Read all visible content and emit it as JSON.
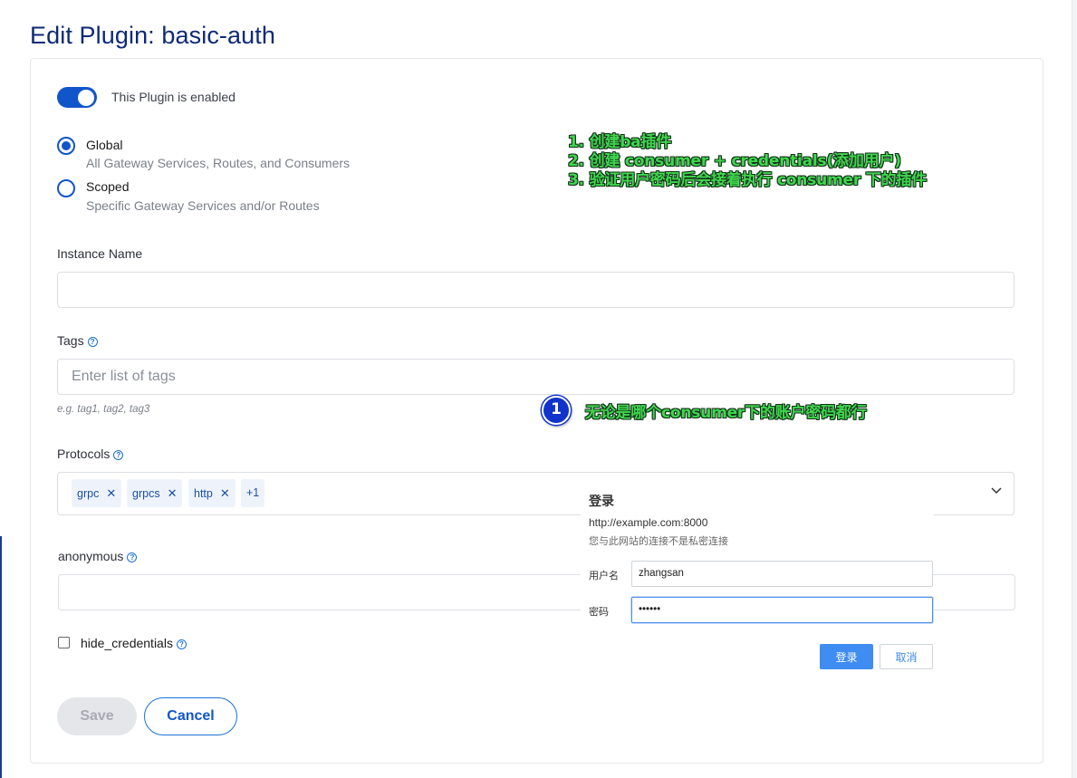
{
  "page": {
    "title": "Edit Plugin: basic-auth"
  },
  "toggle": {
    "label": "This Plugin is enabled",
    "enabled": true
  },
  "scope": {
    "options": [
      {
        "title": "Global",
        "description": "All Gateway Services, Routes, and Consumers",
        "selected": true
      },
      {
        "title": "Scoped",
        "description": "Specific Gateway Services and/or Routes",
        "selected": false
      }
    ]
  },
  "instance_name": {
    "label": "Instance Name",
    "value": ""
  },
  "tags": {
    "label": "Tags",
    "placeholder": "Enter list of tags",
    "hint": "e.g. tag1, tag2, tag3"
  },
  "protocols": {
    "label": "Protocols",
    "chips": [
      "grpc",
      "grpcs",
      "http"
    ],
    "more": "+1",
    "remove_glyph": "✕"
  },
  "anonymous": {
    "label": "anonymous",
    "value": ""
  },
  "hide_credentials": {
    "label": "hide_credentials",
    "checked": false
  },
  "actions": {
    "save": "Save",
    "cancel": "Cancel"
  },
  "annotations": {
    "steps": [
      "1. 创建ba插件",
      "2. 创建 consumer + credentials(添加用户)",
      "3. 验证用户密码后会接着执行 consumer 下的插件"
    ],
    "badge": "1",
    "note": "无论是哪个consumer下的账户密码都行"
  },
  "login_dialog": {
    "title": "登录",
    "url": "http://example.com:8000",
    "warning": "您与此网站的连接不是私密连接",
    "username_label": "用户名",
    "username_value": "zhangsan",
    "password_label": "密码",
    "password_value": "••••••",
    "ok": "登录",
    "cancel": "取消"
  },
  "colors": {
    "primary": "#1155cb",
    "annotation": "#3fd64d",
    "badge": "#1133cc",
    "dialog_primary": "#3f8cf2"
  }
}
